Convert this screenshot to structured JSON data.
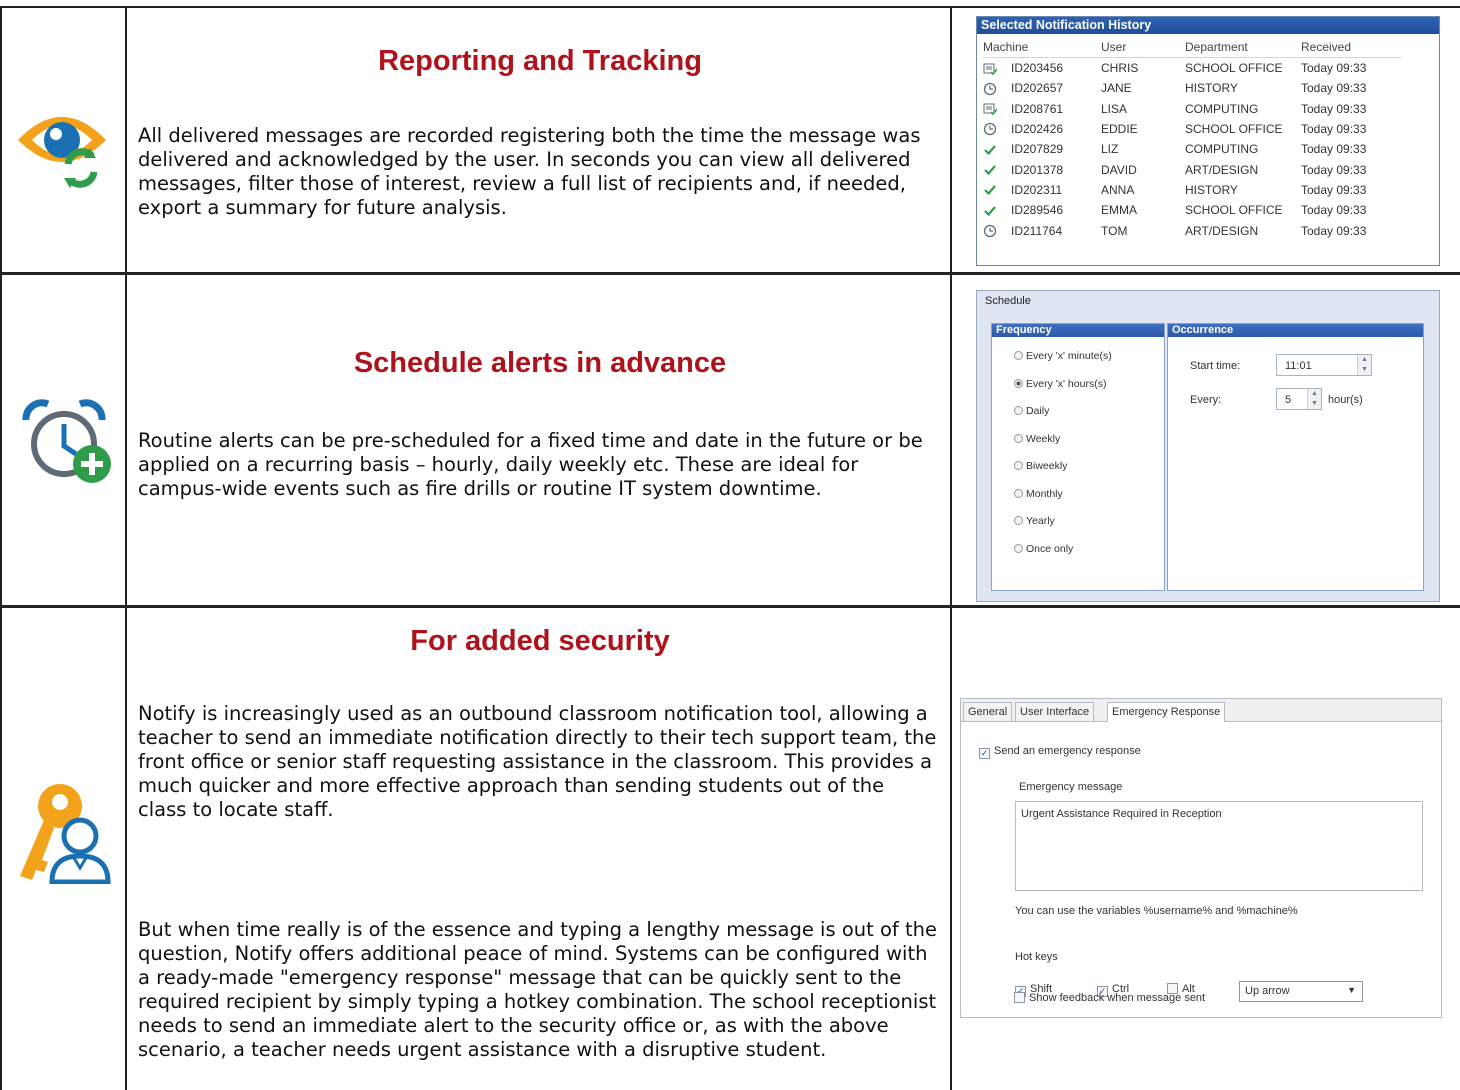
{
  "sections": [
    {
      "title": "Reporting and Tracking",
      "paragraphs": [
        "All delivered messages are recorded registering both the time the message was delivered and acknowledged by the user. In seconds you can view all delivered messages, filter those of interest, review a full list of recipients and, if needed, export a summary for future analysis."
      ],
      "icon": "eye-refresh-icon"
    },
    {
      "title": "Schedule alerts in advance",
      "paragraphs": [
        "Routine alerts can be pre-scheduled for a fixed time and date in the future or be applied on a recurring basis – hourly, daily weekly etc. These are ideal for campus-wide events such as fire drills or routine IT system downtime."
      ],
      "icon": "alarm-clock-add-icon"
    },
    {
      "title": "For added security",
      "paragraphs": [
        "Notify is increasingly used as an outbound classroom notification tool, allowing a teacher to send an immediate notification directly to their tech support team, the front office or senior staff requesting assistance in the classroom. This provides a much quicker and more effective approach than sending students out of the class to locate staff.",
        "But when time really is of the essence and typing a lengthy message is out of the question, Notify offers additional peace of mind. Systems can be configured with a ready-made \"emergency response\" message that can be quickly sent to the required recipient by simply typing a hotkey combination. The school receptionist needs to send an immediate alert to the security office or, as with the above scenario, a teacher needs urgent assistance with a disruptive student."
      ],
      "icon": "key-user-icon"
    }
  ],
  "history": {
    "title": "Selected Notification History",
    "columns": [
      "Machine",
      "User",
      "Department",
      "Received"
    ],
    "rows": [
      {
        "status": "message",
        "machine": "ID203456",
        "user": "CHRIS",
        "department": "SCHOOL OFFICE",
        "received": "Today 09:33"
      },
      {
        "status": "clock",
        "machine": "ID202657",
        "user": "JANE",
        "department": "HISTORY",
        "received": "Today 09:33"
      },
      {
        "status": "message",
        "machine": "ID208761",
        "user": "LISA",
        "department": "COMPUTING",
        "received": "Today 09:33"
      },
      {
        "status": "clock",
        "machine": "ID202426",
        "user": "EDDIE",
        "department": "SCHOOL OFFICE",
        "received": "Today 09:33"
      },
      {
        "status": "check",
        "machine": "ID207829",
        "user": "LIZ",
        "department": "COMPUTING",
        "received": "Today 09:33"
      },
      {
        "status": "check",
        "machine": "ID201378",
        "user": "DAVID",
        "department": "ART/DESIGN",
        "received": "Today 09:33"
      },
      {
        "status": "check",
        "machine": "ID202311",
        "user": "ANNA",
        "department": "HISTORY",
        "received": "Today 09:33"
      },
      {
        "status": "check",
        "machine": "ID289546",
        "user": "EMMA",
        "department": "SCHOOL OFFICE",
        "received": "Today 09:33"
      },
      {
        "status": "clock",
        "machine": "ID211764",
        "user": "TOM",
        "department": "ART/DESIGN",
        "received": "Today 09:33"
      }
    ]
  },
  "schedule": {
    "title": "Schedule",
    "frequency_label": "Frequency",
    "occurrence_label": "Occurrence",
    "options": [
      "Every 'x' minute(s)",
      "Every 'x' hours(s)",
      "Daily",
      "Weekly",
      "Biweekly",
      "Monthly",
      "Yearly",
      "Once only"
    ],
    "selected_index": 1,
    "start_time_label": "Start time:",
    "start_time": "11:01",
    "every_label": "Every:",
    "every_value": "5",
    "every_unit": "hour(s)"
  },
  "emergency": {
    "tabs": [
      "General",
      "User Interface",
      "Emergency Response"
    ],
    "active_tab": 2,
    "send_label": "Send an emergency response",
    "send_checked": true,
    "message_label": "Emergency message",
    "message": "Urgent Assistance Required in Reception",
    "variables_hint": "You can use the variables %username% and %machine%",
    "hotkeys_label": "Hot keys",
    "shift_label": "Shift",
    "shift_checked": true,
    "ctrl_label": "Ctrl",
    "ctrl_checked": true,
    "alt_label": "Alt",
    "alt_checked": false,
    "key_value": "Up arrow",
    "feedback_label": "Show feedback when message sent",
    "feedback_checked": false
  },
  "colors": {
    "title": "#b0121c",
    "icon_blue": "#1b6fb3",
    "icon_orange": "#f2a31b",
    "icon_green": "#2e9c4a",
    "icon_gray": "#5f6a74"
  }
}
